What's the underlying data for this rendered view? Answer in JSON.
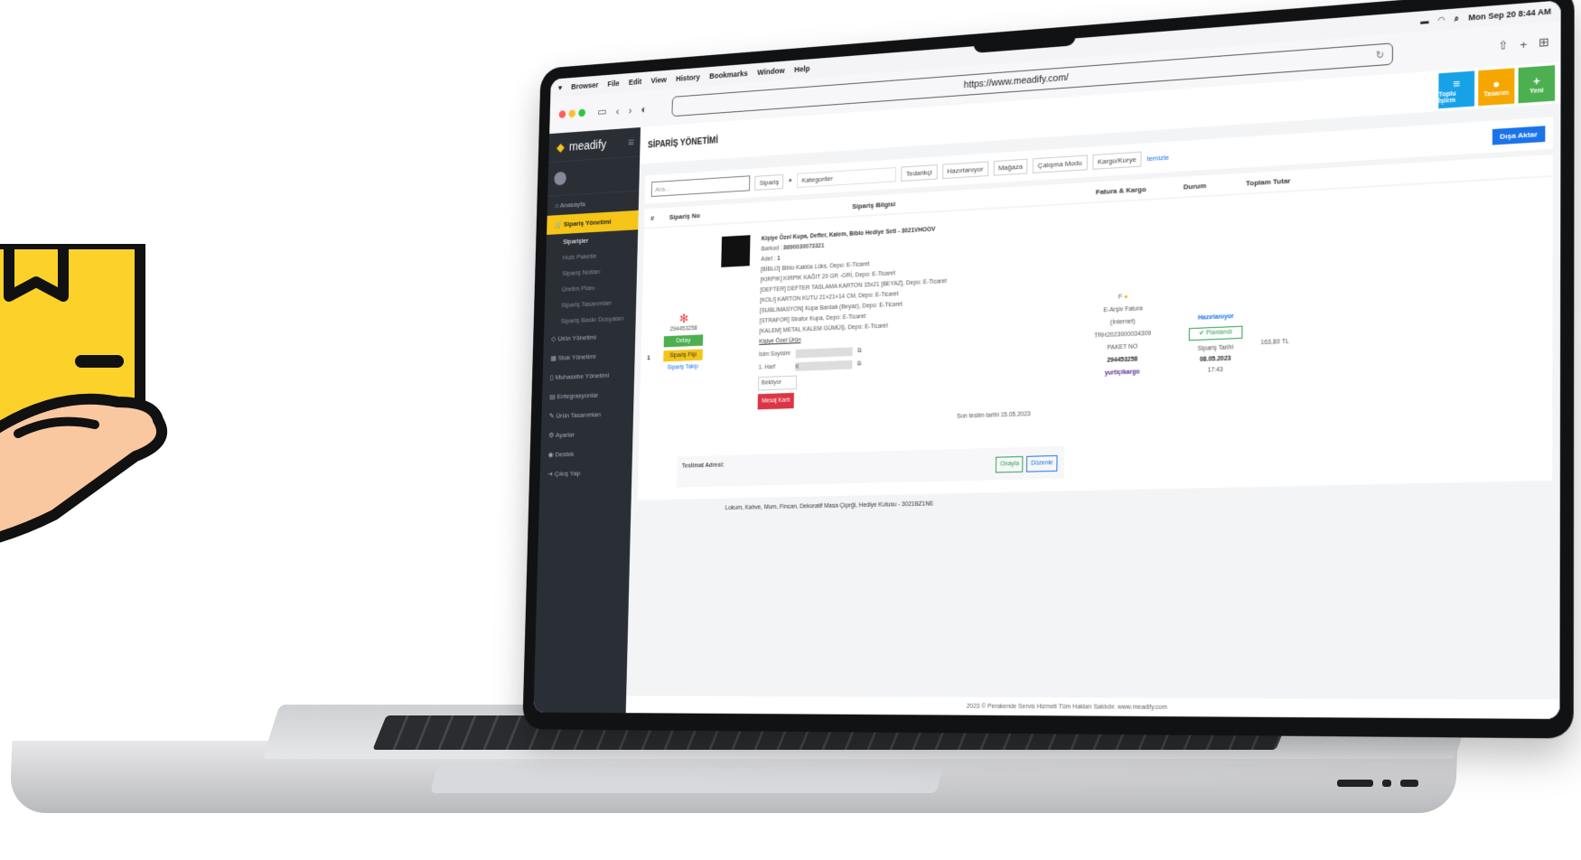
{
  "macos": {
    "apple_icon": "apple-icon",
    "menus": [
      "Browser",
      "File",
      "Edit",
      "View",
      "History",
      "Bookmarks",
      "Window",
      "Help"
    ],
    "datetime": "Mon Sep 20  8:44 AM"
  },
  "browser": {
    "url": "https://www.meadify.com/"
  },
  "colors": {
    "sidebar": "#2a2f36",
    "accent": "#f5c518",
    "primary": "#1a73e8",
    "success": "#2e9e4f",
    "danger": "#dc3545",
    "info": "#17a2e8",
    "orange": "#f5a700",
    "green": "#4caf50"
  },
  "app": {
    "brand": "meadify",
    "page_title": "SİPARİŞ YÖNETİMİ"
  },
  "sidebar": {
    "items": [
      {
        "label": "Anasayfa",
        "icon": "home-icon"
      },
      {
        "label": "Sipariş Yönetimi",
        "icon": "cart-icon",
        "active": true
      },
      {
        "label": "Ürün Yönetimi",
        "icon": "tag-icon"
      },
      {
        "label": "Stok Yönetimi",
        "icon": "boxes-icon"
      },
      {
        "label": "Muhasebe Yönetimi",
        "icon": "document-icon"
      },
      {
        "label": "Entegrasyonlar",
        "icon": "grid-icon"
      },
      {
        "label": "Ürün Tasarımları",
        "icon": "brush-icon"
      },
      {
        "label": "Ayarlar",
        "icon": "gear-icon"
      },
      {
        "label": "Destek",
        "icon": "support-icon"
      },
      {
        "label": "Çıkış Yap",
        "icon": "logout-icon"
      }
    ],
    "subitems": [
      "Siparişler",
      "Hızlı Paketle",
      "Sipariş Notları",
      "Üretim Planı",
      "Sipariş Tasarımları",
      "Sipariş Baskı Dosyaları"
    ]
  },
  "top_buttons": {
    "bulk": "Toplu İşlem",
    "design": "Tasarım",
    "new": "Yeni"
  },
  "filters": {
    "search_placeholder": "Ara...",
    "order": "Sipariş",
    "categories": "Kategoriler",
    "supplier": "Tedarikçi",
    "preparing": "Hazırlanıyor",
    "store": "Mağaza",
    "work_mode": "Çalışma Modu",
    "cargo": "Kargo/Kurye",
    "clear": "temizle",
    "export": "Dışa Aktar"
  },
  "table": {
    "headers": [
      "#",
      "Sipariş No",
      "Sipariş Bilgisi",
      "Fatura & Kargo",
      "Durum",
      "Toplam Tutar"
    ]
  },
  "order": {
    "num": "1",
    "order_no": "294453258",
    "detail_btn": "Detay",
    "receipt_btn": "Sipariş Fişi",
    "track_link": "Sipariş Takip",
    "product_title": "Kişiye Özel Kupa, Defter, Kalem, Biblo Hediye Seti - 3021VHOOV",
    "barcode_label": "Barkod :",
    "barcode": "8690030073321",
    "qty_label": "Adet :",
    "qty": "1",
    "items": [
      "[BİBLO] Biblo Kaktüs Lüks, Depo: E-Ticaret",
      "[KIRPIK] KIRPIK KAĞIT 20 GR -GRİ, Depo: E-Ticaret",
      "[DEFTER] DEFTER TASLAMA KARTON 15x21 [BEYAZ], Depo: E-Ticaret",
      "[KOLİ] KARTON KUTU 21×21×14 CM, Depo: E-Ticaret",
      "[SUBLİMASYON] Kupa Bardak (Beyaz), Depo: E-Ticaret",
      "[STRAFOR] Strafor Kupa, Depo: E-Ticaret",
      "[KALEM] METAL KALEM GÜMÜŞ, Depo: E-Ticaret"
    ],
    "custom_link": "Kişiye Özel Ürün",
    "name_label": "İsim Soyisim",
    "letter_label": "1. Harf",
    "letter_value": "K",
    "wait_select": "Bekliyor",
    "message_btn": "Mesaj Kartı",
    "deadline": "Son teslim tarihi 15.05.2023",
    "address_label": "Teslimat Adresi:",
    "approve_btn": "Onayla",
    "edit_btn": "Düzenle",
    "invoice_letter": "F",
    "invoice_type": "E-Arşiv Fatura",
    "invoice_sub": "(İnternet)",
    "invoice_no": "TRH2023000034309",
    "package_label": "PAKET NO",
    "package_no": "294453258",
    "cargo_brand": "yurtiçikargo",
    "status": "Hazırlanıyor",
    "planned": "Planlandı",
    "date_label": "Sipariş Tarihi",
    "date": "08.05.2023",
    "time": "17:43",
    "total": "163,80 TL"
  },
  "next_row": "Lokum, Kahve, Mum, Fincan, Dekoratif Masa Çiçeği, Hediye Kutusu - 3021BZ1NE",
  "footer": "2023 © Perakende Servis Hizmeti Tüm Hakları Saklıdır. www.meadify.com"
}
